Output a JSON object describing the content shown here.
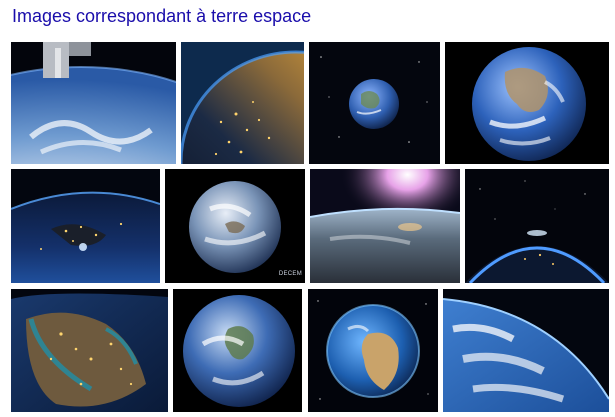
{
  "header": {
    "title": "Images correspondant à terre espace"
  },
  "results": {
    "thumbnails": [
      {
        "subject": "earth-from-orbit-clouds"
      },
      {
        "subject": "earth-night-lights-europe"
      },
      {
        "subject": "earth-globe-in-stars"
      },
      {
        "subject": "earth-blue-marble"
      },
      {
        "subject": "earth-night-lights-curve"
      },
      {
        "subject": "earth-full-globe",
        "caption": "DECEM"
      },
      {
        "subject": "earth-horizon-sunrise"
      },
      {
        "subject": "earth-limb-atmosphere"
      },
      {
        "subject": "earth-night-middle-east"
      },
      {
        "subject": "earth-americas-globe"
      },
      {
        "subject": "earth-africa-globe"
      },
      {
        "subject": "earth-ocean-clouds-curve"
      }
    ]
  },
  "colors": {
    "title_link": "#1a0dab",
    "space_black": "#05070f",
    "ocean_blue": "#1e4f9e",
    "cloud_white": "#f2f5fa",
    "city_light": "#ffc94d"
  }
}
